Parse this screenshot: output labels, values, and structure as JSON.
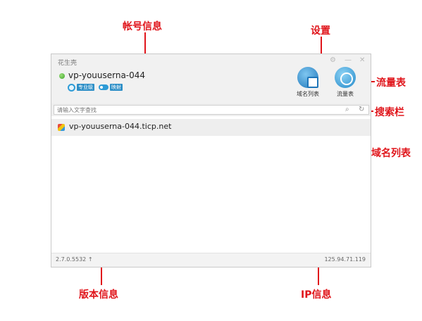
{
  "annotations": {
    "account_info": "帐号信息",
    "settings": "设置",
    "traffic": "流量表",
    "search_bar": "搜索栏",
    "domain_list": "域名列表",
    "version_info": "版本信息",
    "ip_info": "IP信息"
  },
  "window": {
    "title": "花生壳",
    "controls": {
      "settings_glyph": "⚙",
      "minimize_glyph": "—",
      "close_glyph": "✕"
    }
  },
  "account": {
    "name": "vp-youuserna-044",
    "status": "online",
    "badges": [
      "专业级",
      "映射"
    ]
  },
  "toolbar": {
    "domain_list_label": "域名列表",
    "traffic_label": "流量表"
  },
  "search": {
    "placeholder": "请输入文字查找",
    "search_icon": "search-icon",
    "refresh_icon": "refresh-icon"
  },
  "domains": [
    {
      "name": "vp-youuserna-044.ticp.net"
    }
  ],
  "status_bar": {
    "version": "2.7.0.5532",
    "ip": "125.94.71.119"
  },
  "colors": {
    "annotation_red": "#e0151b",
    "accent_blue": "#2e8fc7",
    "online_green": "#3fa52b"
  }
}
